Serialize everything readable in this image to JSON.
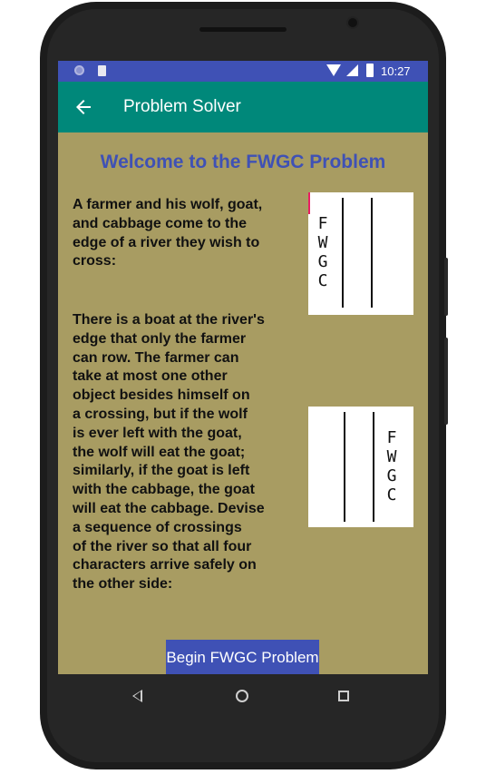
{
  "status_bar": {
    "time": "10:27",
    "icons": [
      "notification-circle-icon",
      "sd-card-icon",
      "wifi-icon",
      "signal-icon",
      "battery-icon"
    ]
  },
  "toolbar": {
    "back_icon": "arrow-left-icon",
    "title": "Problem Solver"
  },
  "main": {
    "heading": "Welcome to the FWGC Problem",
    "paragraph1": "A farmer and his wolf, goat,\nand cabbage come to the\nedge of a river they wish to\ncross:",
    "paragraph2": "There is a boat at the river's\nedge that only the farmer\ncan row. The farmer can\ntake at most one other\nobject besides himself on\na crossing, but if the wolf\nis ever left with the goat,\nthe wolf will eat the goat;\nsimilarly, if the goat is left\nwith the cabbage, the goat\nwill eat the cabbage. Devise\na sequence of crossings\nof the river so that all four\ncharacters arrive safely on\nthe other side:",
    "start_state": {
      "letters": [
        "F",
        "W",
        "G",
        "C"
      ],
      "bank": "left"
    },
    "goal_state": {
      "letters": [
        "F",
        "W",
        "G",
        "C"
      ],
      "bank": "right"
    },
    "begin_button": "Begin FWGC Problem"
  },
  "nav_bar": {
    "icons": [
      "nav-back-icon",
      "nav-home-icon",
      "nav-recents-icon"
    ]
  },
  "colors": {
    "status_bar": "#3f51b5",
    "toolbar": "#00887a",
    "background": "#a89c62",
    "heading": "#3f51b5",
    "button": "#3f51b5",
    "cursor": "#e91e63"
  }
}
